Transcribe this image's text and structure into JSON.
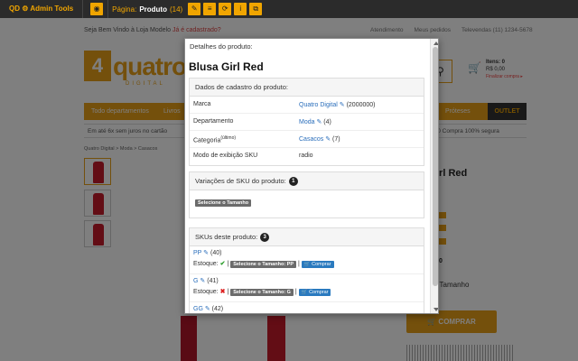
{
  "admin_bar": {
    "brand": "QD ⚙ Admin Tools",
    "page_label": "Página:",
    "page_value": "Produto",
    "page_count": "(14)"
  },
  "store": {
    "welcome": "Seja Bem Vindo à Loja Modelo",
    "welcome_link": "Já é cadastrado?",
    "top_links": [
      "Atendimento",
      "Meus pedidos",
      "Televendas (11) 1234-5678"
    ],
    "logo_text": "quatro",
    "logo_sub": "DIGITAL",
    "cart_items": "Itens: 0",
    "cart_total": "R$ 0,00",
    "cart_link": "Finalizar compra ▸",
    "nav": [
      "Todo departamentos",
      "Livros"
    ],
    "nav_right": "Próteses",
    "nav_outlet": "OUTLET",
    "promo_left": "Em até 6x sem juros no cartão",
    "promo_right": "200   Compra 100% segura",
    "breadcrumb": "Quatro Digital > Moda > Casacos",
    "product_title_partial": "irl Red",
    "price_label": "0",
    "size_label": "o Tamanho",
    "buy_label": "🛒 COMPRAR"
  },
  "modal": {
    "header": "Detalhes do produto:",
    "title": "Blusa Girl Red",
    "registration": {
      "heading": "Dados de cadastro do produto:",
      "rows": [
        {
          "label": "Marca",
          "value": "Quatro Digital",
          "extra": "(2000000)",
          "superscript": ""
        },
        {
          "label": "Departamento",
          "value": "Moda",
          "extra": "(4)",
          "superscript": ""
        },
        {
          "label": "Categoria",
          "value": "Casacos",
          "extra": "(7)",
          "superscript": "(último)"
        },
        {
          "label": "Modo de exibição SKU",
          "value": "radio",
          "extra": "",
          "superscript": ""
        }
      ]
    },
    "variations": {
      "heading": "Variações de SKU do produto:",
      "count": "1",
      "tag": "Selecione o Tamanho"
    },
    "skus": {
      "heading": "SKUs deste produto:",
      "count": "3",
      "stock_label": "Estoque:",
      "buy_label": "Comprar",
      "items": [
        {
          "name": "PP",
          "id": "(40)",
          "in_stock": true,
          "tag": "Selecione o Tamanho: PP"
        },
        {
          "name": "G",
          "id": "(41)",
          "in_stock": false,
          "tag": "Selecione o Tamanho: G"
        },
        {
          "name": "GG",
          "id": "(42)",
          "in_stock": true,
          "tag": ""
        }
      ]
    }
  },
  "colors": {
    "accent": "#e8a018",
    "admin_bg": "#2b2b2b",
    "link": "#2a6ebb",
    "button_blue": "#2a7abf"
  }
}
